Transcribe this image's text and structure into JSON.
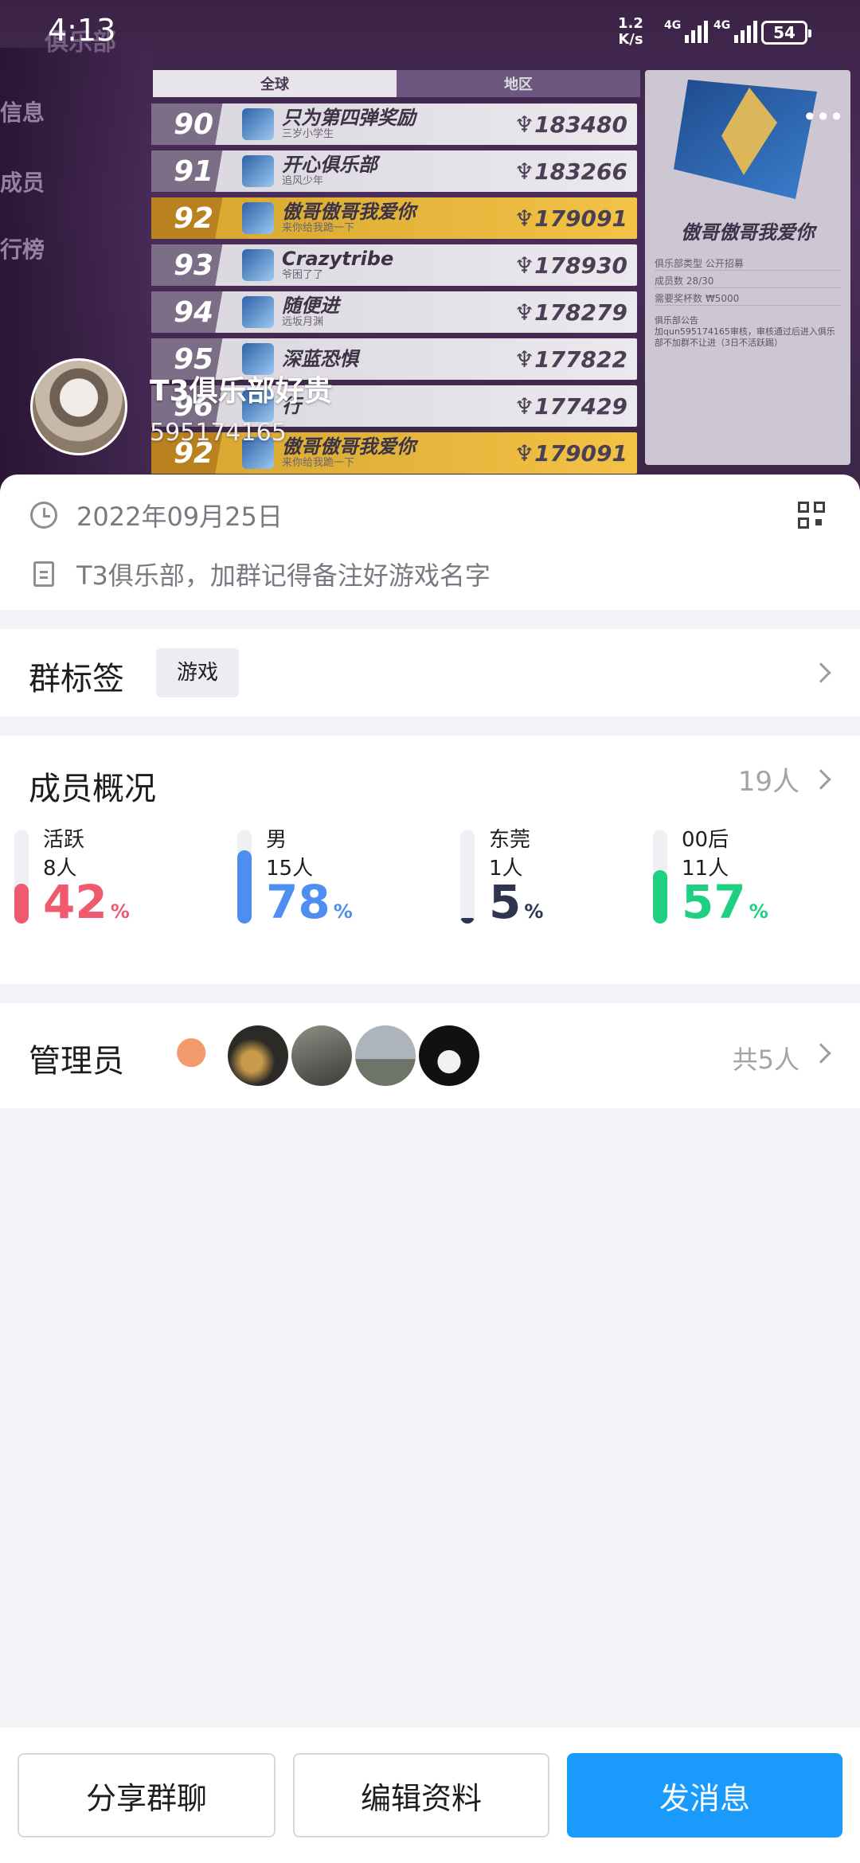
{
  "status_bar": {
    "time": "4:13",
    "net_speed_value": "1.2",
    "net_speed_unit": "K/s",
    "net_type_1": "4G",
    "net_type_2": "4G",
    "battery": "54"
  },
  "cover": {
    "club_title": "俱乐部",
    "side_menu": [
      "信息",
      "成员",
      "行榜"
    ],
    "tabs": [
      "全球",
      "地区"
    ],
    "rankings": [
      {
        "rank": "90",
        "name": "只为第四弹奖励",
        "sub": "三岁小学生",
        "score": "183480",
        "highlight": false
      },
      {
        "rank": "91",
        "name": "开心俱乐部",
        "sub": "追风少年",
        "score": "183266",
        "highlight": false
      },
      {
        "rank": "92",
        "name": "傲哥傲哥我爱你",
        "sub": "来你给我跪一下",
        "score": "179091",
        "highlight": true
      },
      {
        "rank": "93",
        "name": "Crazytribe",
        "sub": "爷困了了",
        "score": "178930",
        "highlight": false
      },
      {
        "rank": "94",
        "name": "随便进",
        "sub": "远坂月渊",
        "score": "178279",
        "highlight": false
      },
      {
        "rank": "95",
        "name": "深蓝恐惧",
        "sub": "",
        "score": "177822",
        "highlight": false
      },
      {
        "rank": "96",
        "name": "行",
        "sub": "",
        "score": "177429",
        "highlight": false
      },
      {
        "rank": "92",
        "name": "傲哥傲哥我爱你",
        "sub": "来你给我跪一下",
        "score": "179091",
        "highlight": true
      }
    ],
    "side_card": {
      "name": "傲哥傲哥我爱你",
      "lines": [
        "俱乐部类型    公开招募",
        "成员数    28/30",
        "需要奖杯数    ₩5000"
      ],
      "notice_label": "俱乐部公告",
      "notice": "加qun595174165审核，审核通过后进入俱乐部不加群不让进（3日不活跃踢）"
    }
  },
  "group": {
    "name": "T3俱乐部好贵",
    "id": "595174165",
    "created_date": "2022年09月25日",
    "description": "T3俱乐部，加群记得备注好游戏名字"
  },
  "tags_section": {
    "title": "群标签",
    "tag": "游戏"
  },
  "members_section": {
    "title": "成员概况",
    "total": "19人",
    "stats": [
      {
        "label": "活跃",
        "count": "8人",
        "percent": "42",
        "unit": "%",
        "color": "#f05a6e",
        "fraction": 0.42
      },
      {
        "label": "男",
        "count": "15人",
        "percent": "78",
        "unit": "%",
        "color": "#4d8ef0",
        "fraction": 0.78
      },
      {
        "label": "东莞",
        "count": "1人",
        "percent": "5",
        "unit": "%",
        "color": "#2f3550",
        "fraction": 0.05
      },
      {
        "label": "00后",
        "count": "11人",
        "percent": "57",
        "unit": "%",
        "color": "#1ed080",
        "fraction": 0.57
      }
    ]
  },
  "admins_section": {
    "title": "管理员",
    "total": "共5人"
  },
  "buttons": {
    "share": "分享群聊",
    "edit": "编辑资料",
    "message": "发消息"
  }
}
